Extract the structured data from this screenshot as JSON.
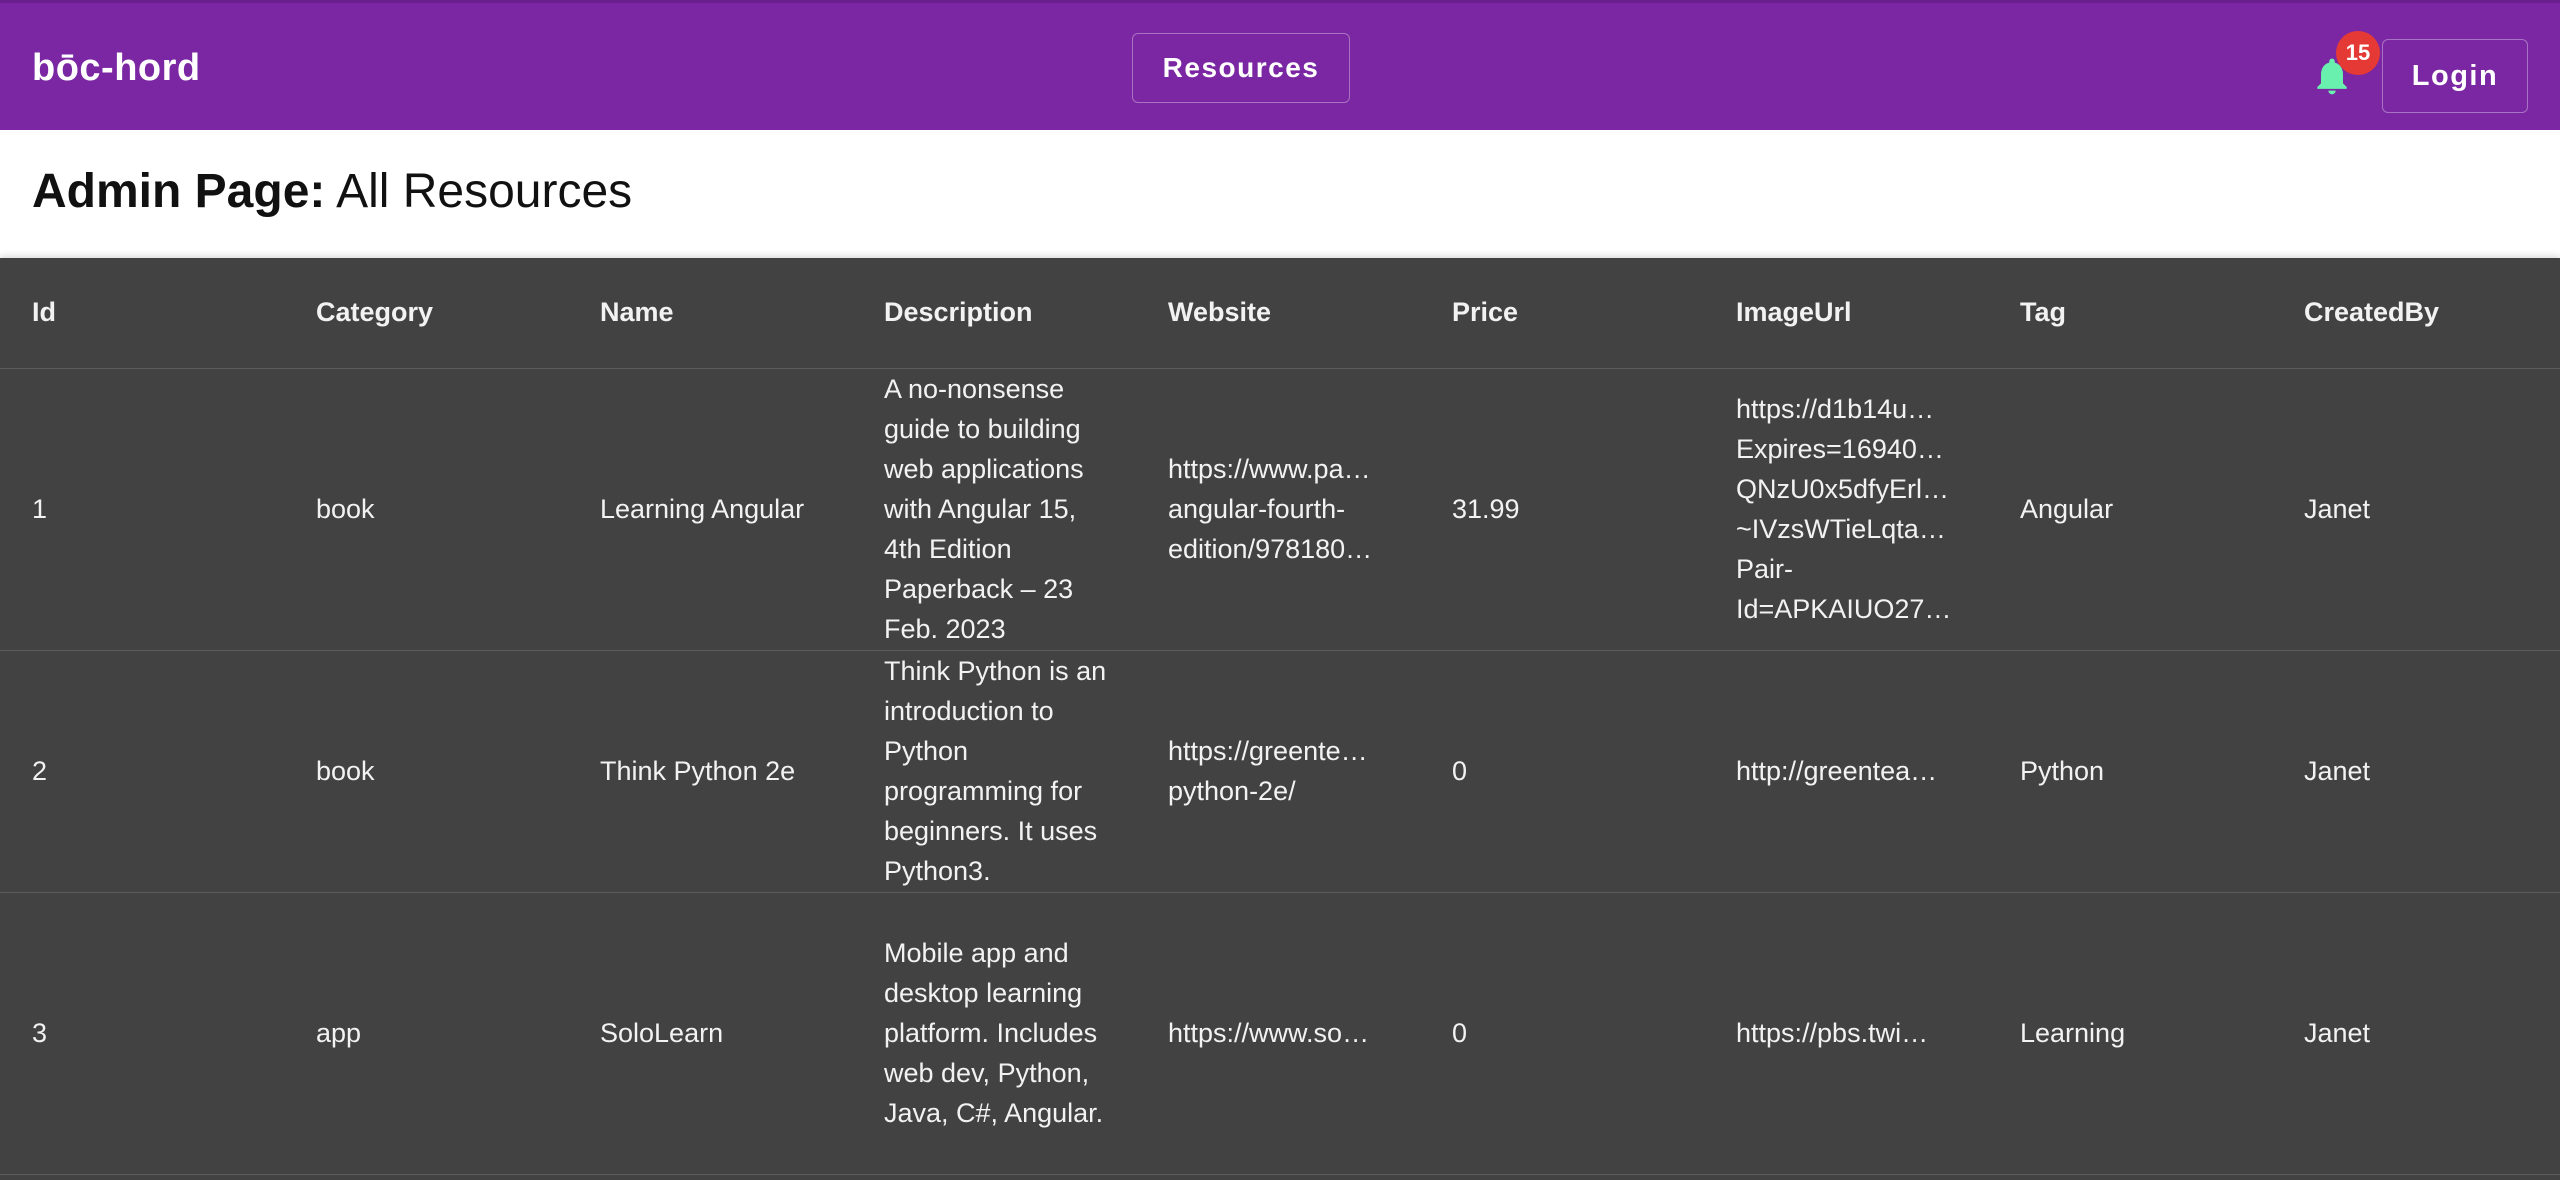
{
  "app": {
    "brand": "bōc-hord",
    "nav_resources": "Resources",
    "notification_count": "15",
    "login_label": "Login",
    "colors": {
      "toolbar": "#7b27a3",
      "bell": "#69f0ae",
      "badge": "#e53935",
      "table_bg": "#424242"
    }
  },
  "page": {
    "title_bold": "Admin Page:",
    "title_rest": " All Resources"
  },
  "table": {
    "headers": [
      "Id",
      "Category",
      "Name",
      "Description",
      "Website",
      "Price",
      "ImageUrl",
      "Tag",
      "CreatedBy"
    ],
    "rows": [
      {
        "id": "1",
        "category": "book",
        "name": "Learning Angular",
        "description": "A no-nonsense guide to building web applications with Angular 15, 4th Edition Paperback – 23 Feb. 2023",
        "website": [
          "https://www.pa…",
          "angular-fourth-",
          "edition/978180…"
        ],
        "price": "31.99",
        "image_url": [
          "https://d1b14u…",
          "Expires=16940…",
          "QNzU0x5dfyErl…",
          "~IVzsWTieLqta…",
          "Pair-",
          "Id=APKAIUO27…"
        ],
        "tag": "Angular",
        "created_by": "Janet"
      },
      {
        "id": "2",
        "category": "book",
        "name": "Think Python 2e",
        "description": "Think Python is an introduction to Python programming for beginners. It uses Python3.",
        "website": [
          "https://greente…",
          "python-2e/"
        ],
        "price": "0",
        "image_url": [
          "http://greentea…"
        ],
        "tag": "Python",
        "created_by": "Janet"
      },
      {
        "id": "3",
        "category": "app",
        "name": "SoloLearn",
        "description": "Mobile app and desktop learning platform. Includes web dev, Python, Java, C#, Angular.",
        "website": [
          "https://www.so…"
        ],
        "price": "0",
        "image_url": [
          "https://pbs.twi…"
        ],
        "tag": "Learning",
        "created_by": "Janet"
      }
    ]
  }
}
